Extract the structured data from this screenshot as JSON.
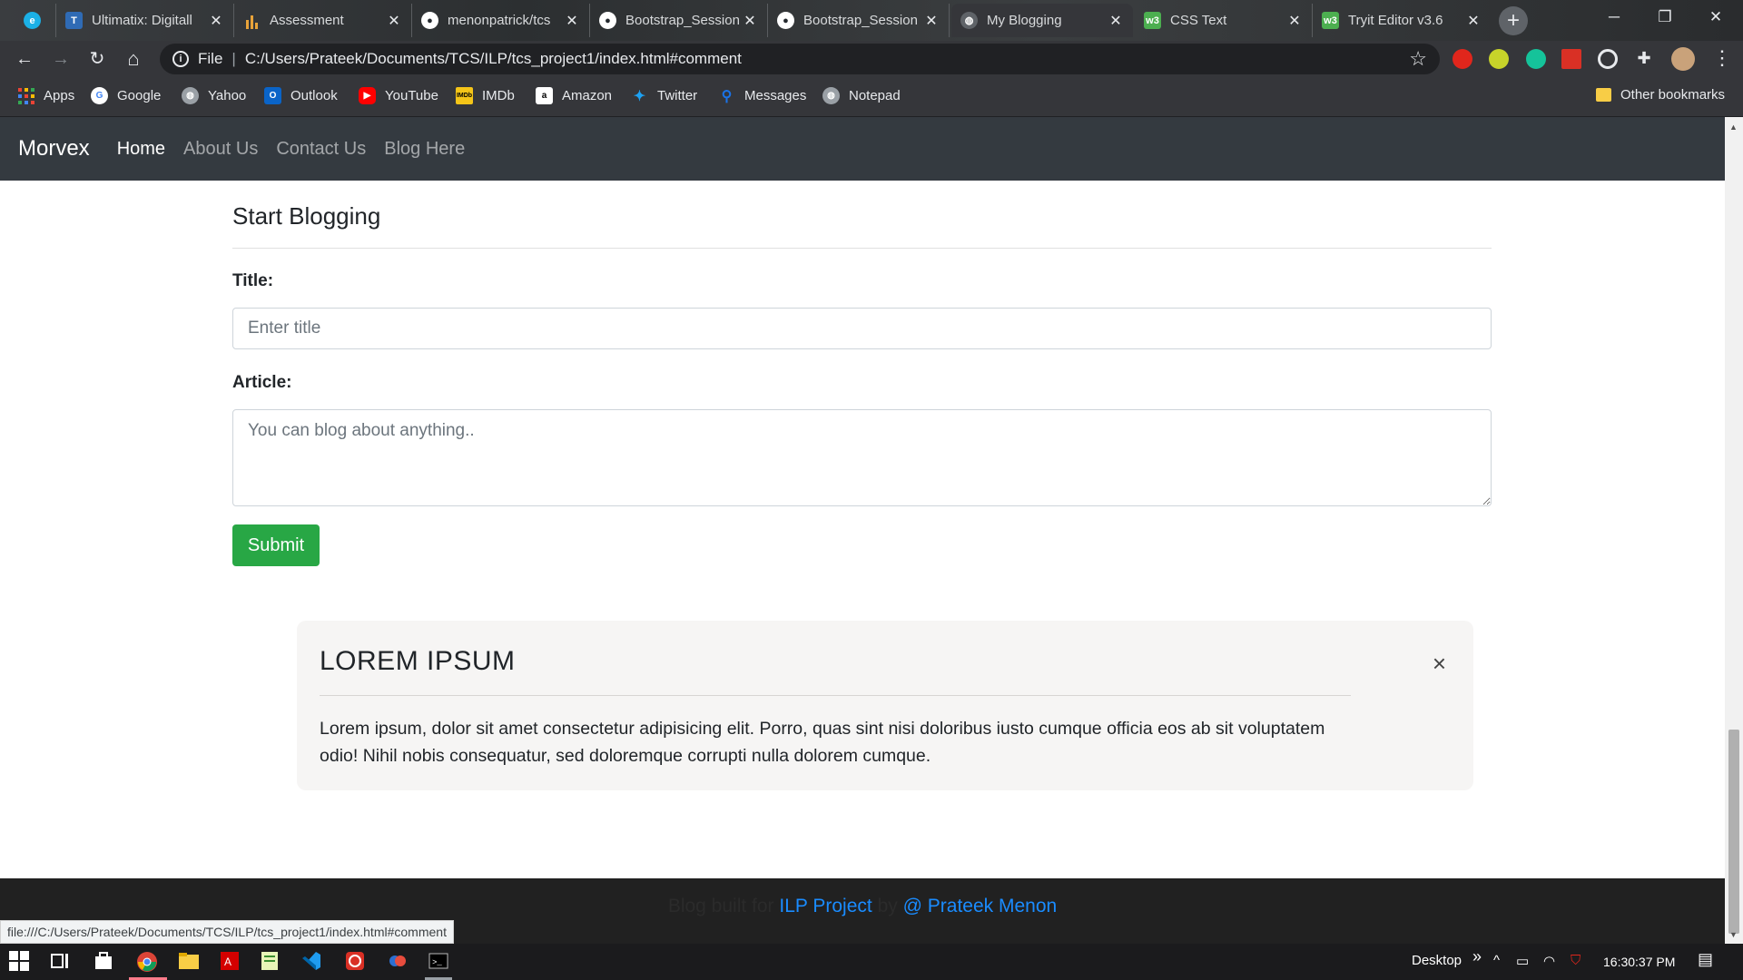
{
  "browser": {
    "tabs": [
      {
        "title": "",
        "icon": "edge-icon",
        "color": "#1bb0e6"
      },
      {
        "title": "Ultimatix: Digitall",
        "icon": "tcs-icon",
        "color": "#2f6bb5"
      },
      {
        "title": "Assessment",
        "icon": "bar-chart-icon",
        "color": "#e8a33a"
      },
      {
        "title": "menonpatrick/tcs",
        "icon": "github-icon",
        "color": "#ffffff"
      },
      {
        "title": "Bootstrap_Session",
        "icon": "github-icon",
        "color": "#ffffff"
      },
      {
        "title": "Bootstrap_Session",
        "icon": "github-icon",
        "color": "#ffffff"
      },
      {
        "title": "My Blogging",
        "icon": "globe-icon",
        "color": "#9aa0a6"
      },
      {
        "title": "CSS Text",
        "icon": "w3schools-icon",
        "color": "#4caf50"
      },
      {
        "title": "Tryit Editor v3.6",
        "icon": "w3schools-icon",
        "color": "#4caf50"
      }
    ],
    "new_tab_symbol": "+",
    "window_controls": {
      "minimize": "─",
      "restore": "❐",
      "close": "✕"
    },
    "address": {
      "info_label": "File",
      "url": "C:/Users/Prateek/Documents/TCS/ILP/tcs_project1/index.html#comment"
    },
    "nav_symbols": {
      "back": "←",
      "forward": "→",
      "reload": "↻",
      "home": "⌂",
      "star": "☆",
      "menu": "⋮"
    },
    "bookmarks": [
      {
        "label": "Apps",
        "icon": "apps-grid-icon",
        "color": "#e94235"
      },
      {
        "label": "Google",
        "icon": "google-icon",
        "color": "#ffffff"
      },
      {
        "label": "Yahoo",
        "icon": "globe-icon",
        "color": "#9aa0a6"
      },
      {
        "label": "Outlook",
        "icon": "outlook-icon",
        "color": "#0a64c8"
      },
      {
        "label": "YouTube",
        "icon": "youtube-icon",
        "color": "#ff0000"
      },
      {
        "label": "IMDb",
        "icon": "imdb-icon",
        "color": "#f5c518"
      },
      {
        "label": "Amazon",
        "icon": "amazon-icon",
        "color": "#ffffff"
      },
      {
        "label": "Twitter",
        "icon": "twitter-icon",
        "color": "#1da1f2"
      },
      {
        "label": "Messages",
        "icon": "messages-icon",
        "color": "#1a73e8"
      },
      {
        "label": "Notepad",
        "icon": "globe-icon",
        "color": "#9aa0a6"
      }
    ],
    "other_bookmarks": "Other bookmarks",
    "status_url": "file:///C:/Users/Prateek/Documents/TCS/ILP/tcs_project1/index.html#comment"
  },
  "site": {
    "brand": "Morvex",
    "nav": [
      "Home",
      "About Us",
      "Contact Us",
      "Blog Here"
    ],
    "form": {
      "heading": "Start Blogging",
      "title_label": "Title:",
      "title_placeholder": "Enter title",
      "article_label": "Article:",
      "article_placeholder": "You can blog about anything..",
      "submit": "Submit"
    },
    "card": {
      "title": "LOREM IPSUM",
      "close": "×",
      "text": "Lorem ipsum, dolor sit amet consectetur adipisicing elit. Porro, quas sint nisi doloribus iusto cumque officia eos ab sit voluptatem odio! Nihil nobis consequatur, sed doloremque corrupti nulla dolorem cumque."
    },
    "footer": {
      "prefix": "Blog built for",
      "link1": "ILP Project",
      "middle": "by",
      "link2": "@ Prateek Menon"
    }
  },
  "taskbar": {
    "desktop_label": "Desktop",
    "chevron": "»",
    "time": "16:30:37 PM",
    "colors": {
      "accent": "#ff7b8a"
    }
  }
}
